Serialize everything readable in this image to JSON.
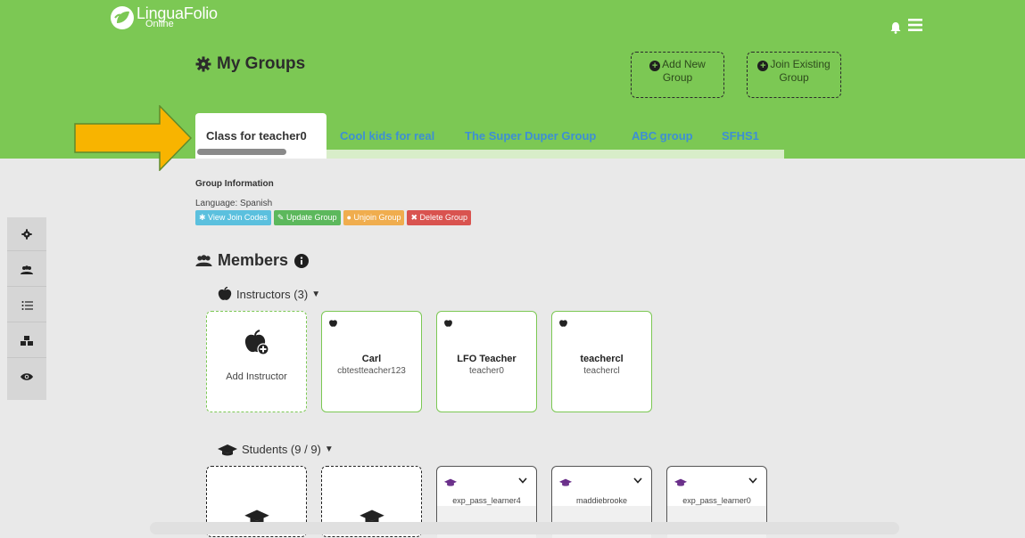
{
  "app": {
    "logo_main": "LinguaFolio",
    "logo_sub": "Online"
  },
  "page": {
    "title": "My Groups"
  },
  "header_buttons": {
    "add_new": "Add New Group",
    "join_existing": "Join Existing Group"
  },
  "tabs": [
    {
      "label": "Class for teacher0",
      "active": true
    },
    {
      "label": "Cool kids for real"
    },
    {
      "label": "The Super Duper Group"
    },
    {
      "label": "ABC group"
    },
    {
      "label": "SFHS1"
    }
  ],
  "group_info": {
    "title": "Group Information",
    "language": "Language: Spanish",
    "actions": [
      "View Join Codes",
      "Update Group",
      "Unjoin Group",
      "Delete Group"
    ]
  },
  "members": {
    "title": "Members",
    "instructors_label": "Instructors (3)",
    "add_instructor": "Add Instructor",
    "instructors": [
      {
        "name": "Carl",
        "username": "cbtestteacher123"
      },
      {
        "name": "LFO Teacher",
        "username": "teacher0"
      },
      {
        "name": "teachercl",
        "username": "teachercl"
      }
    ],
    "students_label": "Students (9 / 9)",
    "students": [
      {
        "username": "exp_pass_learner4"
      },
      {
        "username": "maddiebrooke"
      },
      {
        "username": "exp_pass_learner0"
      }
    ]
  },
  "colors": {
    "brand": "#7cc854",
    "link": "#3d8fd4",
    "view": "#5bc0de",
    "update": "#5cb85c",
    "unjoin": "#f0ad4e",
    "delete": "#d9534f"
  },
  "icons": [
    "logo-leaf-icon",
    "bell-icon",
    "hamburger-menu-icon",
    "gear-icon",
    "plus-circle-icon",
    "arrow-icon",
    "users-icon",
    "list-icon",
    "cubes-icon",
    "eye-icon",
    "info-icon",
    "apple-icon",
    "graduation-cap-icon",
    "chevron-down-icon"
  ]
}
